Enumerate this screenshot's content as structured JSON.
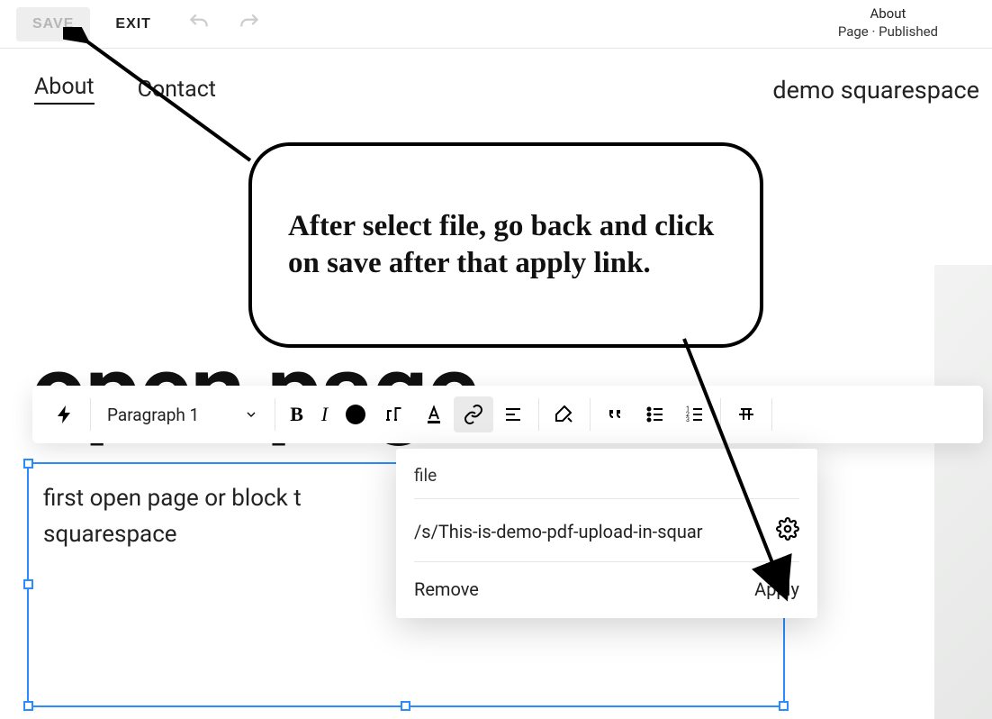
{
  "topbar": {
    "save_label": "SAVE",
    "exit_label": "EXIT"
  },
  "page_meta": {
    "title": "About",
    "subtitle": "Page · Published"
  },
  "nav": {
    "items": [
      "About",
      "Contact"
    ],
    "site_title": "demo squarespace"
  },
  "page_heading": "open page",
  "text_block": {
    "line1": "first open page or block t",
    "line2": "squarespace"
  },
  "toolbar": {
    "style_dropdown": "Paragraph 1"
  },
  "link_popup": {
    "type_label": "file",
    "url": "/s/This-is-demo-pdf-upload-in-squar",
    "remove_label": "Remove",
    "apply_label": "Apply"
  },
  "annotation": {
    "text": "After select file, go back and click on save after that apply link."
  },
  "icons": {
    "bolt": "bolt-icon",
    "chevron_down": "chevron-down-icon",
    "bold": "bold-icon",
    "italic": "italic-icon",
    "color_dot": "color-dot-icon",
    "text_size": "text-size-icon",
    "text_color": "text-color-icon",
    "link": "link-icon",
    "align": "align-icon",
    "paint": "paint-icon",
    "quote": "quote-icon",
    "bullet_list": "bullet-list-icon",
    "numbered_list": "numbered-list-icon",
    "strikethrough": "strikethrough-icon",
    "undo": "undo-icon",
    "redo": "redo-icon",
    "gear": "gear-icon"
  }
}
